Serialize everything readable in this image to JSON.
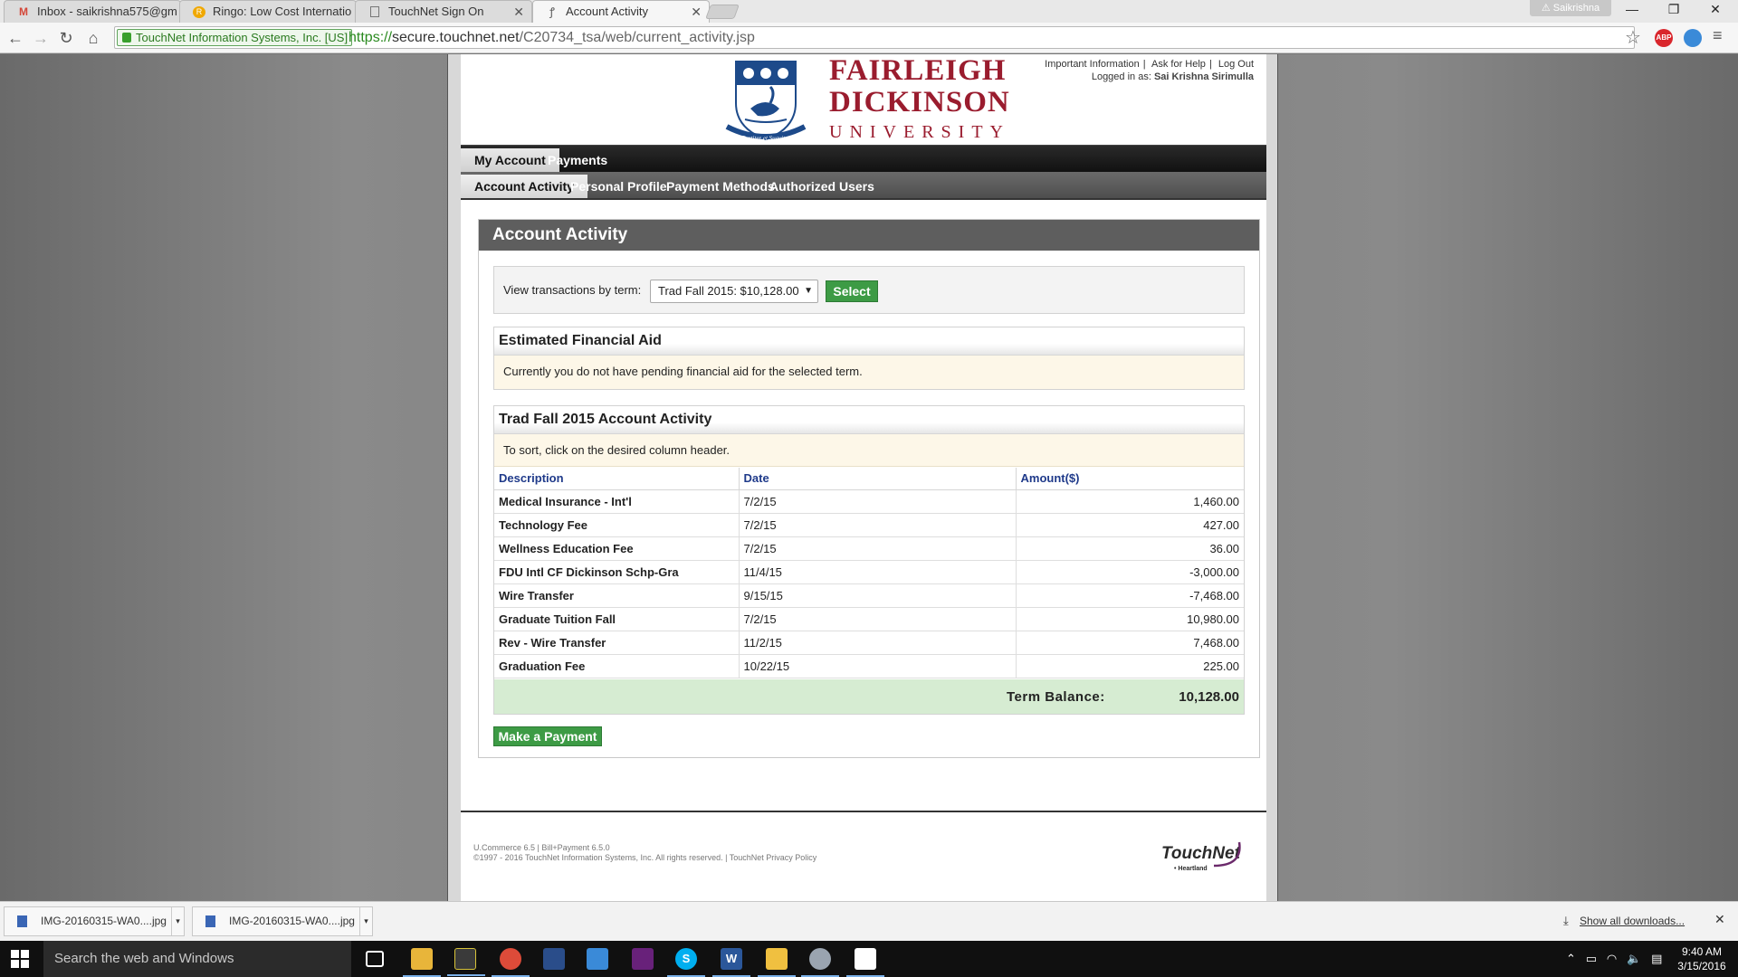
{
  "browser": {
    "tabs": [
      {
        "label": "Inbox - saikrishna575@gm",
        "icon": "gmail-icon"
      },
      {
        "label": "Ringo: Low Cost Internatio",
        "icon": "ringo-icon"
      },
      {
        "label": "TouchNet Sign On",
        "icon": "page-icon"
      },
      {
        "label": "Account Activity",
        "icon": "touchnet-icon",
        "active": true
      }
    ],
    "profile_name": "Saikrishna",
    "ev_cert": "TouchNet Information Systems, Inc. [US]",
    "url": {
      "scheme": "https://",
      "host": "secure.touchnet.net",
      "path": "/C20734_tsa/web/current_activity.jsp"
    },
    "extensions": [
      {
        "name": "abp-icon",
        "label": "ABP",
        "color": "#d9262c"
      },
      {
        "name": "globe-extension-icon",
        "label": "",
        "color": "#3a8ad8"
      }
    ]
  },
  "header": {
    "university": {
      "line1": "FAIRLEIGH",
      "line2": "DICKINSON",
      "line3": "UNIVERSITY"
    },
    "crest_motto": "Fortiter et Suaviter",
    "links": [
      "Important Information",
      "Ask for Help",
      "Log Out"
    ],
    "logged_in_label": "Logged in as:",
    "logged_in_user": "Sai Krishna Sirimulla",
    "brand_color": "#9a1c2e"
  },
  "nav": {
    "primary": [
      {
        "label": "My Account",
        "selected": true
      },
      {
        "label": "Payments",
        "selected": false
      }
    ],
    "secondary": [
      {
        "label": "Account Activity",
        "selected": true
      },
      {
        "label": "Personal Profile",
        "selected": false
      },
      {
        "label": "Payment Methods",
        "selected": false
      },
      {
        "label": "Authorized Users",
        "selected": false
      }
    ]
  },
  "main": {
    "title": "Account Activity",
    "term_label": "View transactions by term:",
    "term_selected": "Trad Fall 2015: $10,128.00",
    "select_button": "Select",
    "financial_aid": {
      "title": "Estimated Financial Aid",
      "message": "Currently you do not have pending financial aid for the selected term."
    },
    "activity": {
      "title": "Trad Fall 2015 Account Activity",
      "sort_hint": "To sort, click on the desired column header.",
      "columns": [
        "Description",
        "Date",
        "Amount($)"
      ],
      "rows": [
        {
          "description": "Medical Insurance - Int'l",
          "date": "7/2/15",
          "amount": "1,460.00"
        },
        {
          "description": "Technology Fee",
          "date": "7/2/15",
          "amount": "427.00"
        },
        {
          "description": "Wellness Education Fee",
          "date": "7/2/15",
          "amount": "36.00"
        },
        {
          "description": "FDU Intl CF Dickinson Schp-Gra",
          "date": "11/4/15",
          "amount": "-3,000.00"
        },
        {
          "description": "Wire Transfer",
          "date": "9/15/15",
          "amount": "-7,468.00"
        },
        {
          "description": "Graduate Tuition Fall",
          "date": "7/2/15",
          "amount": "10,980.00"
        },
        {
          "description": "Rev - Wire Transfer",
          "date": "11/2/15",
          "amount": "7,468.00"
        },
        {
          "description": "Graduation Fee",
          "date": "10/22/15",
          "amount": "225.00"
        }
      ],
      "balance_label": "Term Balance:",
      "balance_value": "10,128.00"
    },
    "pay_button": "Make a Payment"
  },
  "footer": {
    "version": "U.Commerce 6.5 | Bill+Payment 6.5.0",
    "copyright": "©1997 -  2016 TouchNet Information Systems, Inc. All rights reserved. | TouchNet Privacy Policy",
    "logo_text": "TouchNet",
    "logo_sub": "• Heartland"
  },
  "downloads": {
    "items": [
      "IMG-20160315-WA0....jpg",
      "IMG-20160315-WA0....jpg"
    ],
    "show_all": "Show all downloads..."
  },
  "taskbar": {
    "search_placeholder": "Search the web and Windows",
    "time": "9:40 AM",
    "date": "3/15/2016"
  }
}
